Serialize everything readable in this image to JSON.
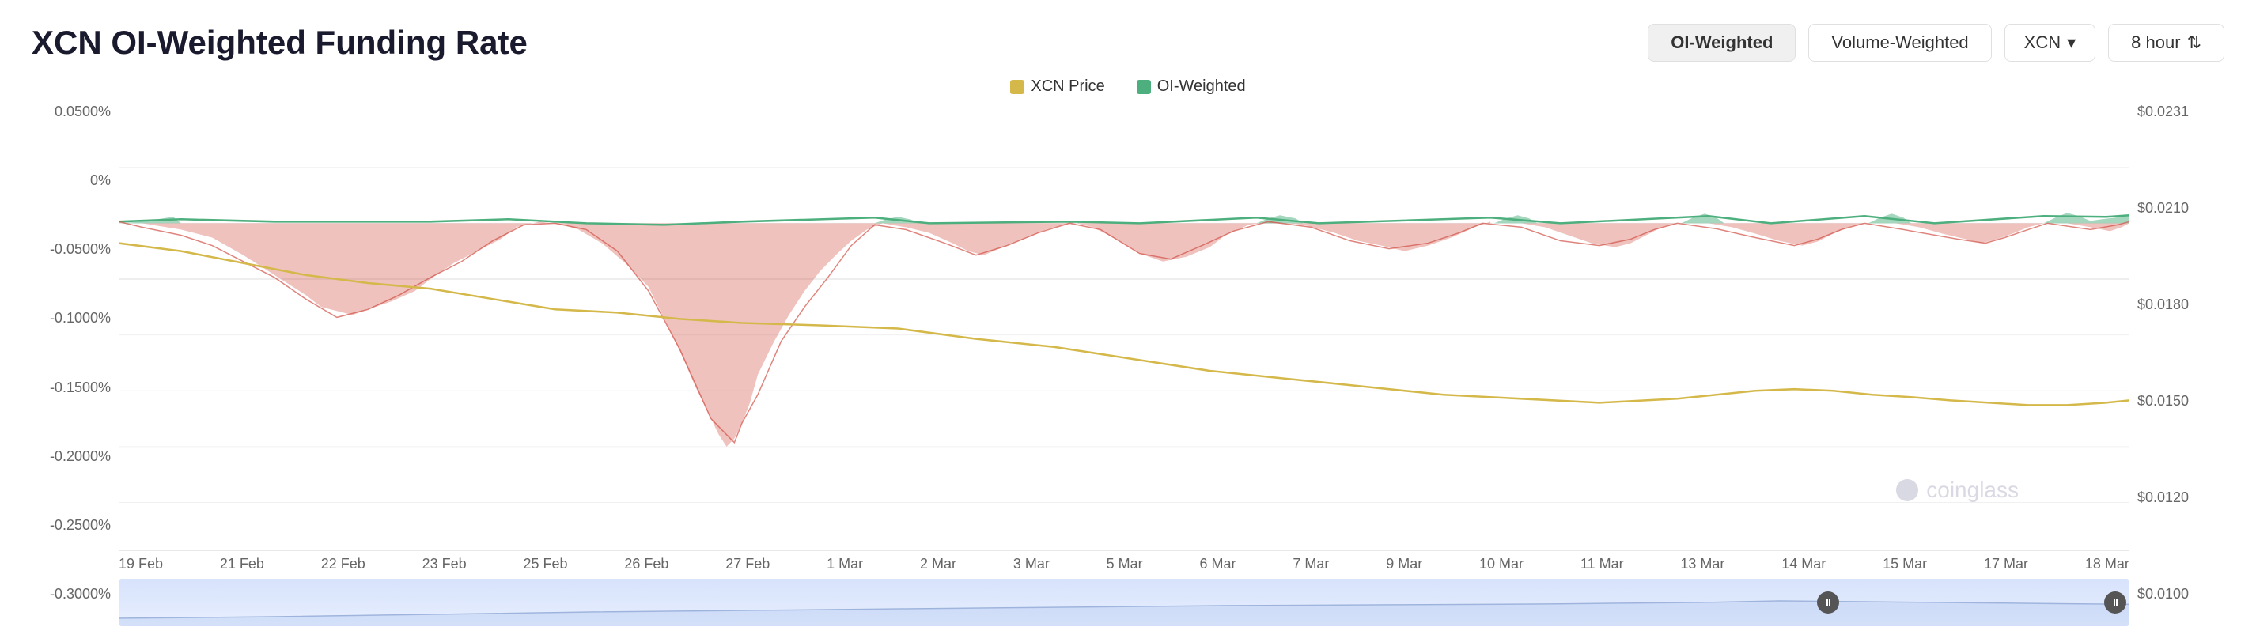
{
  "title": "XCN OI-Weighted Funding Rate",
  "controls": {
    "tab1": "OI-Weighted",
    "tab2": "Volume-Weighted",
    "coin": "XCN",
    "interval": "8 hour"
  },
  "legend": {
    "item1": "XCN Price",
    "item2": "OI-Weighted",
    "color1": "#d4b84a",
    "color2": "#4caf7d"
  },
  "yAxisLeft": [
    "0.0500%",
    "0%",
    "-0.0500%",
    "-0.1000%",
    "-0.1500%",
    "-0.2000%",
    "-0.2500%",
    "-0.3000%"
  ],
  "yAxisRight": [
    "$0.0231",
    "$0.0210",
    "$0.0180",
    "$0.0150",
    "$0.0120",
    "$0.0100"
  ],
  "xAxis": [
    "19 Feb",
    "21 Feb",
    "22 Feb",
    "23 Feb",
    "25 Feb",
    "26 Feb",
    "27 Feb",
    "1 Mar",
    "2 Mar",
    "3 Mar",
    "5 Mar",
    "6 Mar",
    "7 Mar",
    "9 Mar",
    "10 Mar",
    "11 Mar",
    "13 Mar",
    "14 Mar",
    "15 Mar",
    "17 Mar",
    "18 Mar"
  ],
  "watermark": "coinglass",
  "chart": {
    "zeroLineY": 0.18,
    "fundingAreaColor": "rgba(220,80,80,0.4)",
    "positiveAreaColor": "rgba(76,175,125,0.4)",
    "priceLineColor": "#d4b84a",
    "fundingLineColor": "#4caf7d"
  }
}
